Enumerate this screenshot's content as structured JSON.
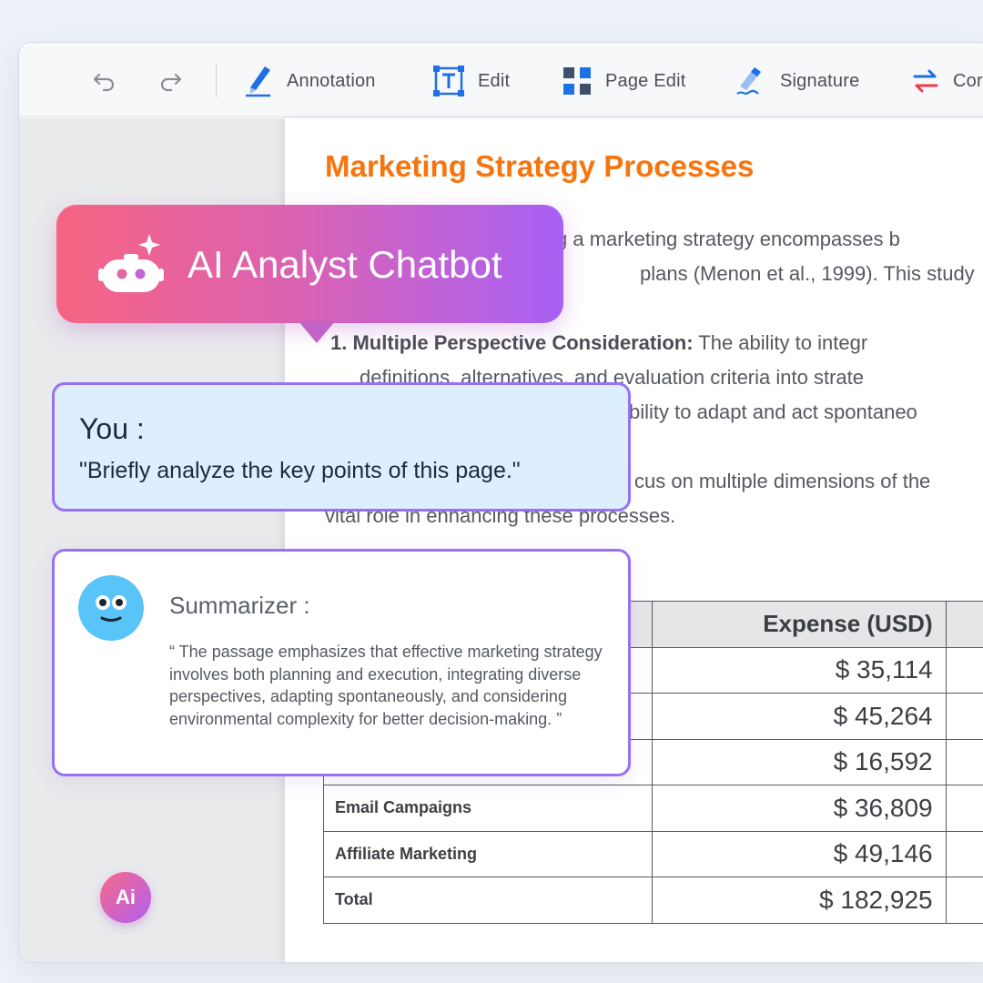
{
  "toolbar": {
    "undo_icon": "undo-icon",
    "redo_icon": "redo-icon",
    "items": [
      {
        "label": "Annotation",
        "icon": "pen-icon"
      },
      {
        "label": "Edit",
        "icon": "text-edit-icon"
      },
      {
        "label": "Page Edit",
        "icon": "grid-icon"
      },
      {
        "label": "Signature",
        "icon": "signature-icon"
      },
      {
        "label": "Cor",
        "icon": "convert-icon"
      }
    ]
  },
  "document": {
    "title": "Marketing Strategy Processes",
    "lines": [
      "g a marketing strategy encompasses b",
      "plans (Menon et al., 1999). This study",
      "definitions, alternatives, and evaluation criteria into strate",
      "bility to adapt and act spontaneo",
      "cus on multiple dimensions of the",
      "vital role in enhancing these processes."
    ],
    "list_item": {
      "number": "1.",
      "bold": "Multiple Perspective Consideration:",
      "rest": " The ability to integr"
    },
    "table": {
      "header": "Expense (USD)",
      "rows": [
        {
          "category": "",
          "value": "$ 35,114"
        },
        {
          "category": "",
          "value": "$ 45,264"
        },
        {
          "category": "",
          "value": "$ 16,592"
        },
        {
          "category": "Email Campaigns",
          "value": "$ 36,809"
        },
        {
          "category": "Affiliate Marketing",
          "value": "$ 49,146"
        },
        {
          "category": "Total",
          "value": "$ 182,925"
        }
      ]
    }
  },
  "chat": {
    "title": "AI Analyst Chatbot",
    "user_label": "You :",
    "user_message": "\"Briefly analyze the key points of this page.\"",
    "bot_label": "Summarizer :",
    "bot_message": "“ The passage emphasizes that effective marketing strategy involves both planning and execution, integrating diverse perspectives, adapting spontaneously, and considering environmental complexity for better decision-making. ”"
  },
  "ai_button": {
    "label": "Ai"
  },
  "colors": {
    "accent_orange": "#f6750f",
    "chat_gradient_start": "#f76482",
    "chat_gradient_end": "#a761f4",
    "chat_border": "#9a70f5",
    "toolbar_icon_blue": "#1f6fe5"
  }
}
